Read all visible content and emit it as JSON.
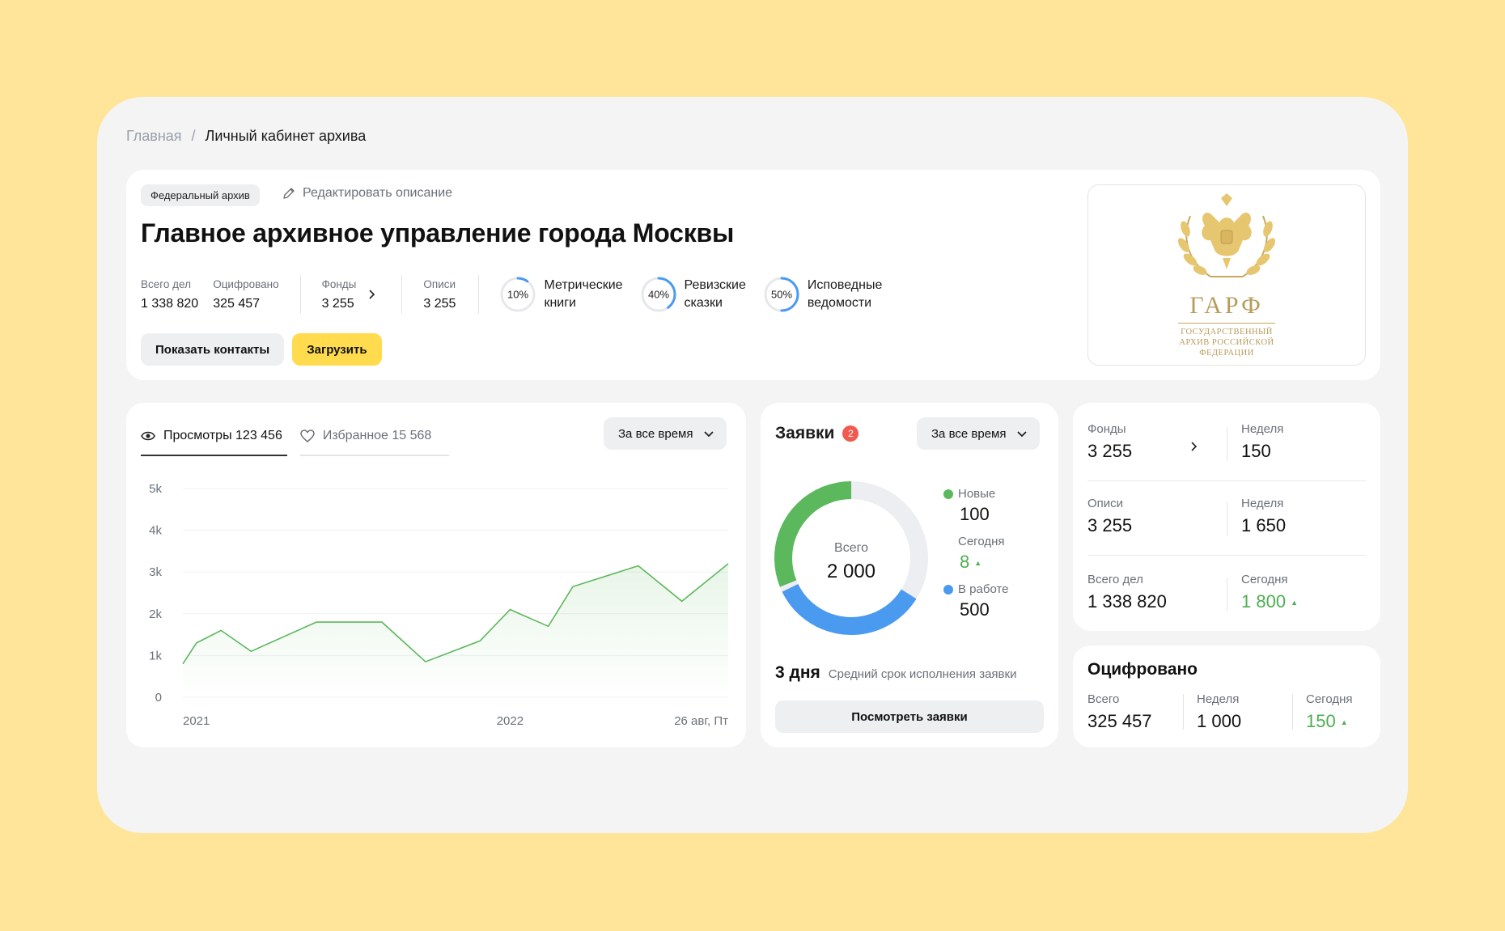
{
  "breadcrumb": {
    "home": "Главная",
    "separator": "/",
    "current": "Личный кабинет архива"
  },
  "header": {
    "badge": "Федеральный архив",
    "edit_label": "Редактировать описание",
    "title": "Главное архивное управление города Москвы",
    "stats": [
      {
        "label": "Всего дел",
        "value": "1 338 820"
      },
      {
        "label": "Оцифровано",
        "value": "325 457"
      },
      {
        "label": "Фонды",
        "value": "3 255"
      },
      {
        "label": "Описи",
        "value": "3 255"
      }
    ],
    "progress": [
      {
        "percent": 10,
        "percent_label": "10%",
        "line1": "Метрические",
        "line2": "книги"
      },
      {
        "percent": 40,
        "percent_label": "40%",
        "line1": "Ревизские",
        "line2": "сказки"
      },
      {
        "percent": 50,
        "percent_label": "50%",
        "line1": "Исповедные",
        "line2": "ведомости"
      }
    ],
    "buttons": {
      "contacts": "Показать контакты",
      "upload": "Загрузить"
    },
    "logo": {
      "letters": "ГАРФ",
      "sub1": "ГОСУДАРСТВЕННЫЙ",
      "sub2": "АРХИВ РОССИЙСКОЙ",
      "sub3": "ФЕДЕРАЦИИ"
    }
  },
  "views": {
    "tab_views": "Просмотры 123 456",
    "tab_favorites": "Избранное 15 568",
    "period": "За все время"
  },
  "chart_data": {
    "type": "area",
    "title": "",
    "xlabel": "",
    "ylabel": "",
    "y_ticks": [
      "0",
      "1k",
      "2k",
      "3k",
      "4k",
      "5k"
    ],
    "x_ticks": [
      {
        "label": "2021",
        "x": 0
      },
      {
        "label": "2022",
        "x": 0.6
      },
      {
        "label": "26 авг, Пт",
        "x": 1
      }
    ],
    "ylim": [
      0,
      5000
    ],
    "x": [
      0,
      0.025,
      0.07,
      0.125,
      0.245,
      0.365,
      0.445,
      0.545,
      0.6,
      0.67,
      0.715,
      0.835,
      0.915,
      1.0
    ],
    "values": [
      800,
      1300,
      1600,
      1100,
      1800,
      1800,
      850,
      1350,
      2100,
      1700,
      2650,
      3150,
      2300,
      3200
    ],
    "color": "#5CB85C",
    "grid": true
  },
  "requests": {
    "title": "Заявки",
    "badge_count": "2",
    "period": "За все время",
    "donut": {
      "total_label": "Всего",
      "total_value": "2 000",
      "segments": [
        {
          "name": "Новые",
          "value": 100,
          "color": "#5CB85C"
        },
        {
          "name": "В работе",
          "value": 500,
          "color": "#4A9AF0"
        }
      ]
    },
    "legend": {
      "new_label": "Новые",
      "new_value": "100",
      "today_label": "Сегодня",
      "today_value": "8",
      "work_label": "В работе",
      "work_value": "500"
    },
    "avg_value": "3 дня",
    "avg_label": "Средний срок исполнения заявки",
    "view_button": "Посмотреть заявки"
  },
  "summary": {
    "rows": [
      {
        "l1": "Фонды",
        "v1": "3 255",
        "l2": "Неделя",
        "v2": "150"
      },
      {
        "l1": "Описи",
        "v1": "3 255",
        "l2": "Неделя",
        "v2": "1 650"
      },
      {
        "l1": "Всего дел",
        "v1": "1 338 820",
        "l2": "Сегодня",
        "v2": "1 800"
      }
    ]
  },
  "digitized": {
    "title": "Оцифровано",
    "total_label": "Всего",
    "total_value": "325 457",
    "week_label": "Неделя",
    "week_value": "1 000",
    "today_label": "Сегодня",
    "today_value": "150"
  },
  "colors": {
    "accent_yellow": "#FFDB4D",
    "green": "#5CB85C",
    "blue": "#4A9AF0",
    "badge_red": "#F05A4F",
    "logo_gold": "#B79C5A"
  }
}
